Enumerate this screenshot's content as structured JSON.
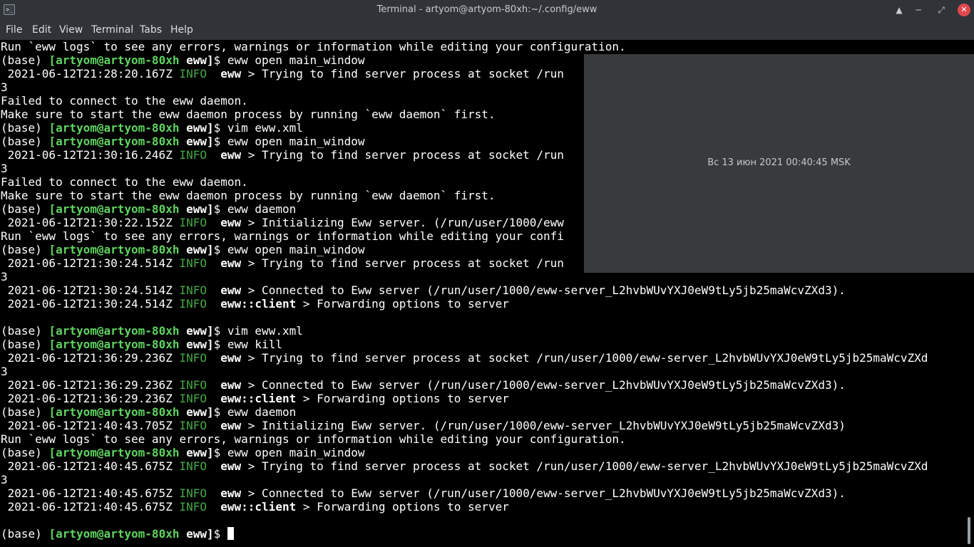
{
  "window": {
    "title": "Terminal - artyom@artyom-80xh:~/.config/eww"
  },
  "icons": {
    "app": "terminal-icon",
    "buttons": [
      "keep-above-icon",
      "minimize-icon",
      "maximize-icon",
      "close-icon"
    ]
  },
  "menu": [
    "File",
    "Edit",
    "View",
    "Terminal",
    "Tabs",
    "Help"
  ],
  "prompt": {
    "env": "(base)",
    "user_host": "[artyom@artyom-80xh",
    "dir": "eww]",
    "symbol": "$"
  },
  "terminal": {
    "lines": [
      [
        [
          "Run `eww logs` to see any errors, warnings or information while editing your configuration.",
          ""
        ]
      ],
      [
        [
          "(base) ",
          ""
        ],
        [
          "[artyom@artyom-80xh ",
          "g"
        ],
        [
          "eww]",
          "b"
        ],
        [
          "$ eww open main_window",
          ""
        ]
      ],
      [
        [
          " 2021-06-12T21:28:20.167Z ",
          ""
        ],
        [
          "INFO",
          "i"
        ],
        [
          "  ",
          ""
        ],
        [
          "eww",
          "b"
        ],
        [
          " > Trying to find server process at socket /run",
          ""
        ]
      ],
      [
        [
          "3",
          ""
        ]
      ],
      [
        [
          "Failed to connect to the eww daemon.",
          ""
        ]
      ],
      [
        [
          "Make sure to start the eww daemon process by running `eww daemon` first.",
          ""
        ]
      ],
      [
        [
          "(base) ",
          ""
        ],
        [
          "[artyom@artyom-80xh ",
          "g"
        ],
        [
          "eww]",
          "b"
        ],
        [
          "$ vim eww.xml",
          ""
        ]
      ],
      [
        [
          "(base) ",
          ""
        ],
        [
          "[artyom@artyom-80xh ",
          "g"
        ],
        [
          "eww]",
          "b"
        ],
        [
          "$ eww open main_window",
          ""
        ]
      ],
      [
        [
          " 2021-06-12T21:30:16.246Z ",
          ""
        ],
        [
          "INFO",
          "i"
        ],
        [
          "  ",
          ""
        ],
        [
          "eww",
          "b"
        ],
        [
          " > Trying to find server process at socket /run",
          ""
        ]
      ],
      [
        [
          "3",
          ""
        ]
      ],
      [
        [
          "Failed to connect to the eww daemon.",
          ""
        ]
      ],
      [
        [
          "Make sure to start the eww daemon process by running `eww daemon` first.",
          ""
        ]
      ],
      [
        [
          "(base) ",
          ""
        ],
        [
          "[artyom@artyom-80xh ",
          "g"
        ],
        [
          "eww]",
          "b"
        ],
        [
          "$ eww daemon",
          ""
        ]
      ],
      [
        [
          " 2021-06-12T21:30:22.152Z ",
          ""
        ],
        [
          "INFO",
          "i"
        ],
        [
          "  ",
          ""
        ],
        [
          "eww",
          "b"
        ],
        [
          " > Initializing Eww server. (/run/user/1000/eww",
          ""
        ]
      ],
      [
        [
          "Run `eww logs` to see any errors, warnings or information while editing your confi",
          ""
        ]
      ],
      [
        [
          "(base) ",
          ""
        ],
        [
          "[artyom@artyom-80xh ",
          "g"
        ],
        [
          "eww]",
          "b"
        ],
        [
          "$ eww open main_window",
          ""
        ]
      ],
      [
        [
          " 2021-06-12T21:30:24.514Z ",
          ""
        ],
        [
          "INFO",
          "i"
        ],
        [
          "  ",
          ""
        ],
        [
          "eww",
          "b"
        ],
        [
          " > Trying to find server process at socket /run",
          ""
        ]
      ],
      [
        [
          "3",
          ""
        ]
      ],
      [
        [
          " 2021-06-12T21:30:24.514Z ",
          ""
        ],
        [
          "INFO",
          "i"
        ],
        [
          "  ",
          ""
        ],
        [
          "eww",
          "b"
        ],
        [
          " > Connected to Eww server (/run/user/1000/eww-server_L2hvbWUvYXJ0eW9tLy5jb25maWcvZXd3).",
          ""
        ]
      ],
      [
        [
          " 2021-06-12T21:30:24.514Z ",
          ""
        ],
        [
          "INFO",
          "i"
        ],
        [
          "  ",
          ""
        ],
        [
          "eww::client",
          "b"
        ],
        [
          " > Forwarding options to server",
          ""
        ]
      ],
      [
        [
          "",
          ""
        ]
      ],
      [
        [
          "(base) ",
          ""
        ],
        [
          "[artyom@artyom-80xh ",
          "g"
        ],
        [
          "eww]",
          "b"
        ],
        [
          "$ vim eww.xml",
          ""
        ]
      ],
      [
        [
          "(base) ",
          ""
        ],
        [
          "[artyom@artyom-80xh ",
          "g"
        ],
        [
          "eww]",
          "b"
        ],
        [
          "$ eww kill",
          ""
        ]
      ],
      [
        [
          " 2021-06-12T21:36:29.236Z ",
          ""
        ],
        [
          "INFO",
          "i"
        ],
        [
          "  ",
          ""
        ],
        [
          "eww",
          "b"
        ],
        [
          " > Trying to find server process at socket /run/user/1000/eww-server_L2hvbWUvYXJ0eW9tLy5jb25maWcvZXd",
          ""
        ]
      ],
      [
        [
          "3",
          ""
        ]
      ],
      [
        [
          " 2021-06-12T21:36:29.236Z ",
          ""
        ],
        [
          "INFO",
          "i"
        ],
        [
          "  ",
          ""
        ],
        [
          "eww",
          "b"
        ],
        [
          " > Connected to Eww server (/run/user/1000/eww-server_L2hvbWUvYXJ0eW9tLy5jb25maWcvZXd3).",
          ""
        ]
      ],
      [
        [
          " 2021-06-12T21:36:29.236Z ",
          ""
        ],
        [
          "INFO",
          "i"
        ],
        [
          "  ",
          ""
        ],
        [
          "eww::client",
          "b"
        ],
        [
          " > Forwarding options to server",
          ""
        ]
      ],
      [
        [
          "(base) ",
          ""
        ],
        [
          "[artyom@artyom-80xh ",
          "g"
        ],
        [
          "eww]",
          "b"
        ],
        [
          "$ eww daemon",
          ""
        ]
      ],
      [
        [
          " 2021-06-12T21:40:43.705Z ",
          ""
        ],
        [
          "INFO",
          "i"
        ],
        [
          "  ",
          ""
        ],
        [
          "eww",
          "b"
        ],
        [
          " > Initializing Eww server. (/run/user/1000/eww-server_L2hvbWUvYXJ0eW9tLy5jb25maWcvZXd3)",
          ""
        ]
      ],
      [
        [
          "Run `eww logs` to see any errors, warnings or information while editing your configuration.",
          ""
        ]
      ],
      [
        [
          "(base) ",
          ""
        ],
        [
          "[artyom@artyom-80xh ",
          "g"
        ],
        [
          "eww]",
          "b"
        ],
        [
          "$ eww open main_window",
          ""
        ]
      ],
      [
        [
          " 2021-06-12T21:40:45.675Z ",
          ""
        ],
        [
          "INFO",
          "i"
        ],
        [
          "  ",
          ""
        ],
        [
          "eww",
          "b"
        ],
        [
          " > Trying to find server process at socket /run/user/1000/eww-server_L2hvbWUvYXJ0eW9tLy5jb25maWcvZXd",
          ""
        ]
      ],
      [
        [
          "3",
          ""
        ]
      ],
      [
        [
          " 2021-06-12T21:40:45.675Z ",
          ""
        ],
        [
          "INFO",
          "i"
        ],
        [
          "  ",
          ""
        ],
        [
          "eww",
          "b"
        ],
        [
          " > Connected to Eww server (/run/user/1000/eww-server_L2hvbWUvYXJ0eW9tLy5jb25maWcvZXd3).",
          ""
        ]
      ],
      [
        [
          " 2021-06-12T21:40:45.675Z ",
          ""
        ],
        [
          "INFO",
          "i"
        ],
        [
          "  ",
          ""
        ],
        [
          "eww::client",
          "b"
        ],
        [
          " > Forwarding options to server",
          ""
        ]
      ],
      [
        [
          "",
          ""
        ]
      ]
    ]
  },
  "eww_window": {
    "clock": "Вс 13 июн 2021 00:40:45 MSK"
  },
  "colors": {
    "titlebar": "#303438",
    "terminal_bg": "#000000",
    "prompt_green": "#5fd35f",
    "info_green": "#44a844",
    "close_red": "#e0474c",
    "overlay": "#383a3e"
  }
}
